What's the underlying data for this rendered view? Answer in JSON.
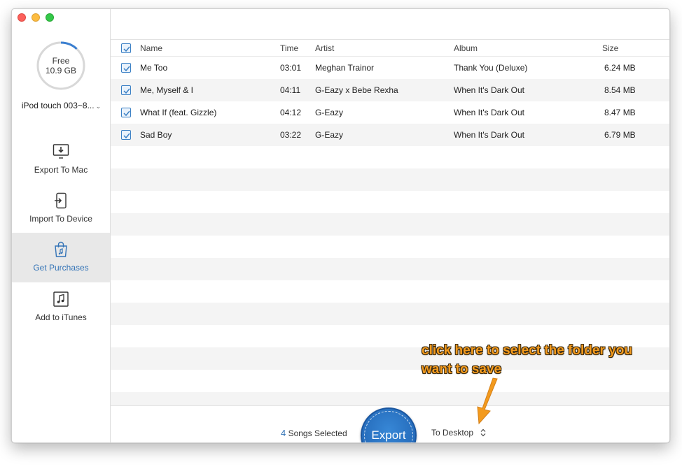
{
  "sidebar": {
    "storage": {
      "free_label": "Free",
      "capacity": "10.9 GB",
      "used_fraction": 0.12
    },
    "device_name": "iPod touch 003~8...",
    "nav": [
      {
        "label": "Export To Mac",
        "icon": "monitor-download-icon",
        "active": false
      },
      {
        "label": "Import To Device",
        "icon": "device-import-icon",
        "active": false
      },
      {
        "label": "Get Purchases",
        "icon": "shopping-bag-icon",
        "active": true
      },
      {
        "label": "Add to iTunes",
        "icon": "music-note-icon",
        "active": false
      }
    ]
  },
  "table": {
    "columns": {
      "name": "Name",
      "time": "Time",
      "artist": "Artist",
      "album": "Album",
      "size": "Size"
    },
    "rows": [
      {
        "name": "Me Too",
        "time": "03:01",
        "artist": "Meghan Trainor",
        "album": "Thank You (Deluxe)",
        "size": "6.24 MB",
        "checked": true
      },
      {
        "name": "Me, Myself & I",
        "time": "04:11",
        "artist": "G-Eazy x Bebe Rexha",
        "album": "When It's Dark Out",
        "size": "8.54 MB",
        "checked": true
      },
      {
        "name": "What If (feat. Gizzle)",
        "time": "04:12",
        "artist": "G-Eazy",
        "album": "When It's Dark Out",
        "size": "8.47 MB",
        "checked": true
      },
      {
        "name": "Sad Boy",
        "time": "03:22",
        "artist": "G-Eazy",
        "album": "When It's Dark Out",
        "size": "6.79 MB",
        "checked": true
      }
    ]
  },
  "footer": {
    "selected_count": "4",
    "selected_label": "Songs Selected",
    "export_label": "Export",
    "destination": "To Desktop"
  },
  "annotation": {
    "line1": "click here to select the folder you",
    "line2": "want to save"
  },
  "colors": {
    "accent": "#3474b7",
    "annotation": "#f39a1d",
    "storage_ring": "#d8d8d8",
    "storage_used": "#3a7fd0"
  }
}
